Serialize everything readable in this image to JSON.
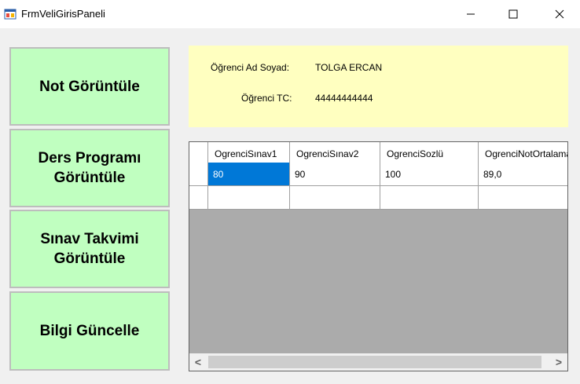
{
  "window": {
    "title": "FrmVeliGirisPaneli",
    "minimize_glyph": "—",
    "maximize_glyph": "☐",
    "close_glyph": "✕",
    "icon": "winforms-app-icon"
  },
  "sidebar": {
    "buttons": [
      {
        "label": "Not Görüntüle"
      },
      {
        "label": "Ders Programı\nGörüntüle"
      },
      {
        "label": "Sınav Takvimi\nGörüntüle"
      },
      {
        "label": "Bilgi Güncelle"
      }
    ],
    "button_color": "#c0ffc0"
  },
  "info": {
    "name_label": "Öğrenci Ad Soyad:",
    "name_value": "TOLGA ERCAN",
    "tc_label": "Öğrenci TC:",
    "tc_value": "44444444444",
    "panel_color": "#ffffc0"
  },
  "grid": {
    "columns": [
      "OgrenciSınav1",
      "OgrenciSınav2",
      "OgrenciSozlü",
      "OgrenciNotOrtalaması"
    ],
    "rows": [
      [
        "80",
        "90",
        "100",
        "89,0"
      ]
    ],
    "selection_color": "#0078d7",
    "scroll_left": "<",
    "scroll_right": ">"
  }
}
